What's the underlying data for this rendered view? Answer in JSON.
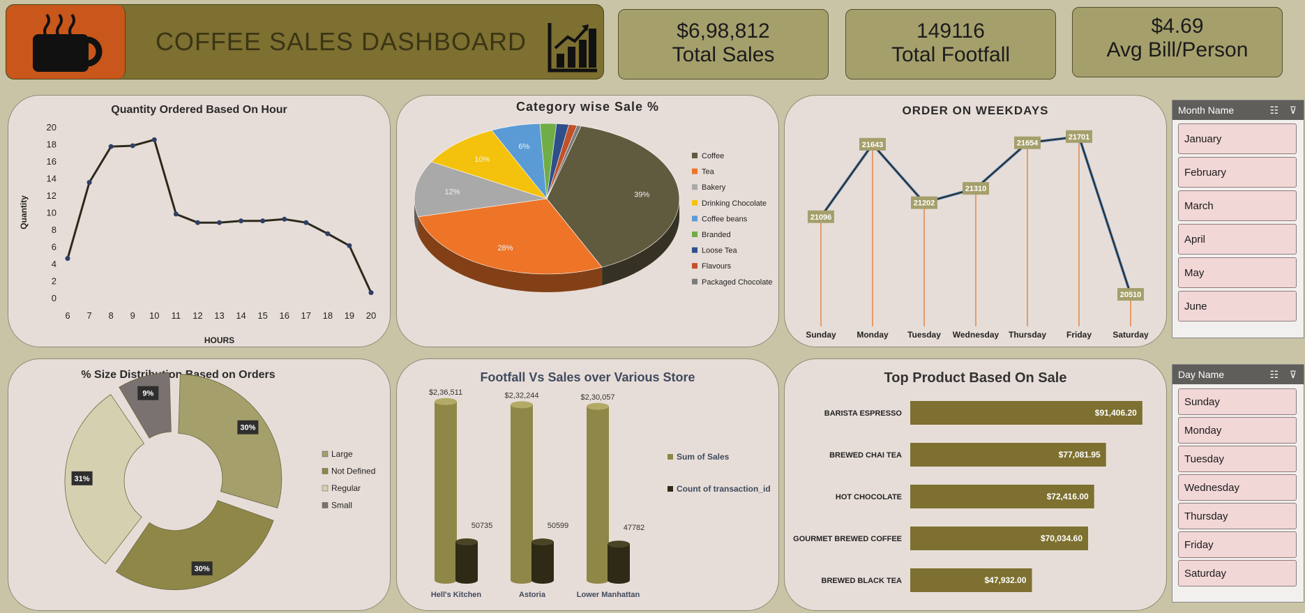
{
  "header": {
    "title": "COFFEE SALES DASHBOARD",
    "cup_icon": "coffee-cup-icon",
    "chart_icon": "bar-chart-growth-icon"
  },
  "kpis": [
    {
      "value": "$6,98,812",
      "label": "Total Sales"
    },
    {
      "value": "149116",
      "label": "Total Footfall"
    },
    {
      "value": "$4.69",
      "label": "Avg Bill/Person"
    }
  ],
  "colors": {
    "accent": "#7d7030",
    "cup_bg": "#c9561a",
    "panel": "#e7ddd8",
    "background": "#c9c4a6"
  },
  "chart_data": [
    {
      "type": "line",
      "title": "Quantity Ordered Based On Hour",
      "xlabel": "HOURS",
      "ylabel": "Quantity",
      "x": [
        6,
        7,
        8,
        9,
        10,
        11,
        12,
        13,
        14,
        15,
        16,
        17,
        18,
        19,
        20
      ],
      "values": [
        4.6,
        13.5,
        17.7,
        17.8,
        18.5,
        9.8,
        8.8,
        8.8,
        9.0,
        9.0,
        9.2,
        8.8,
        7.5,
        6.1,
        0.6
      ],
      "ylim": [
        0,
        20
      ],
      "yticks": [
        0,
        2,
        4,
        6,
        8,
        10,
        12,
        14,
        16,
        18,
        20
      ],
      "grid": false
    },
    {
      "type": "pie",
      "title": "Category wise Sale %",
      "categories": [
        "Coffee",
        "Tea",
        "Bakery",
        "Drinking Chocolate",
        "Coffee beans",
        "Branded",
        "Loose Tea",
        "Flavours",
        "Packaged Chocolate"
      ],
      "values": [
        39,
        28,
        12,
        10,
        6,
        2,
        1.5,
        1,
        0.5
      ],
      "data_labels": [
        "39%",
        "28%",
        "12%",
        "10%",
        "6%",
        "",
        "",
        "",
        ""
      ],
      "colors": [
        "#605a3f",
        "#ee7428",
        "#a9a9a9",
        "#f4c20d",
        "#5b9bd5",
        "#70ad47",
        "#2f4f8a",
        "#c0522a",
        "#7b7b7b"
      ],
      "legend": "right"
    },
    {
      "type": "line",
      "title": "ORDER ON WEEKDAYS",
      "categories": [
        "Sunday",
        "Monday",
        "Tuesday",
        "Wednesday",
        "Thursday",
        "Friday",
        "Saturday"
      ],
      "values": [
        21096,
        21643,
        21202,
        21310,
        21654,
        21701,
        20510
      ],
      "data_labels": [
        "21096",
        "21643",
        "21202",
        "21310",
        "21654",
        "21701",
        "20510"
      ],
      "ylim": [
        20300,
        21800
      ],
      "drop_lines": true
    },
    {
      "type": "pie",
      "subtype": "doughnut",
      "title": "% Size Distribution Based on Orders",
      "categories": [
        "Large",
        "Not Defined",
        "Regular",
        "Small"
      ],
      "values": [
        30,
        30,
        31,
        9
      ],
      "data_labels": [
        "30%",
        "30%",
        "31%",
        "9%"
      ],
      "colors": [
        "#a59f6c",
        "#8f8748",
        "#d5d0b0",
        "#7a7270"
      ],
      "legend": "right"
    },
    {
      "type": "bar",
      "title": "Footfall Vs Sales over Various Store",
      "categories": [
        "Hell's Kitchen",
        "Astoria",
        "Lower Manhattan"
      ],
      "series": [
        {
          "name": "Sum of Sales",
          "values": [
            236511,
            232244,
            230057
          ],
          "labels": [
            "$2,36,511",
            "$2,32,244",
            "$2,30,057"
          ],
          "color": "#8f8748"
        },
        {
          "name": "Count of transaction_id",
          "values": [
            50735,
            50599,
            47782
          ],
          "labels": [
            "50735",
            "50599",
            "47782"
          ],
          "color": "#2e2a16"
        }
      ],
      "ylim": [
        0,
        240000
      ],
      "legend": "right"
    },
    {
      "type": "bar",
      "orientation": "horizontal",
      "title": "Top Product Based On Sale",
      "categories": [
        "BARISTA ESPRESSO",
        "BREWED CHAI TEA",
        "HOT CHOCOLATE",
        "GOURMET BREWED COFFEE",
        "BREWED BLACK TEA"
      ],
      "values": [
        91406.2,
        77081.95,
        72416.0,
        70034.6,
        47932.0
      ],
      "data_labels": [
        "$91,406.20",
        "$77,081.95",
        "$72,416.00",
        "$70,034.60",
        "$47,932.00"
      ],
      "xlim": [
        0,
        92000
      ],
      "color": "#7d7030"
    }
  ],
  "slicers": {
    "month": {
      "header": "Month Name",
      "items": [
        "January",
        "February",
        "March",
        "April",
        "May",
        "June"
      ]
    },
    "day": {
      "header": "Day Name",
      "items": [
        "Sunday",
        "Monday",
        "Tuesday",
        "Wednesday",
        "Thursday",
        "Friday",
        "Saturday"
      ]
    }
  }
}
